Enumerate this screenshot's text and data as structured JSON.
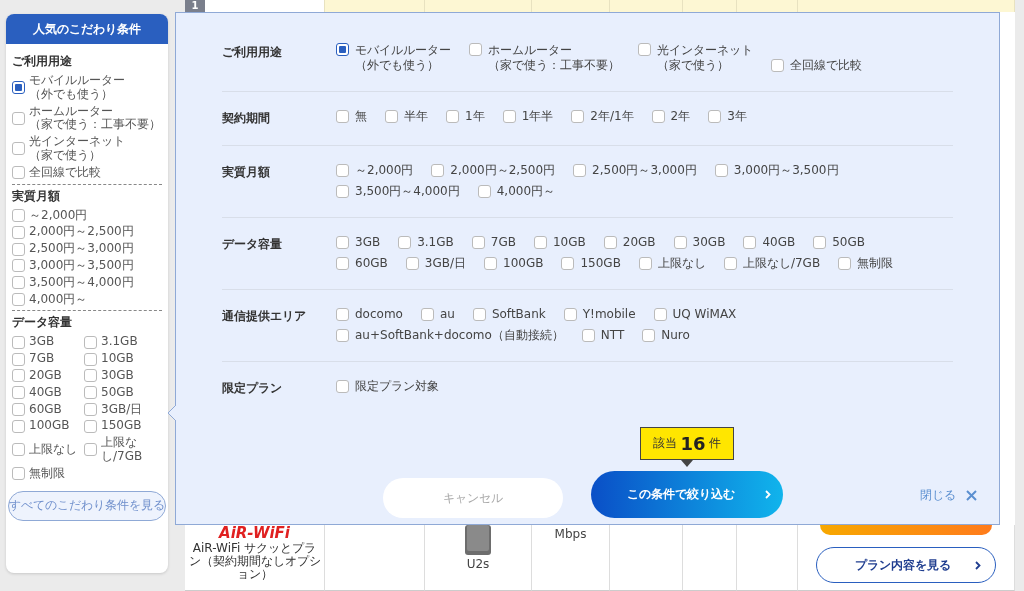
{
  "sidebar": {
    "title": "人気のこだわり条件",
    "sections": [
      {
        "heading": "ご利用用途",
        "kind": "list",
        "options": [
          {
            "label": "モバイルルーター",
            "note": "（外でも使う）",
            "checked": true
          },
          {
            "label": "ホームルーター",
            "note": "（家で使う：工事不要）",
            "checked": false
          },
          {
            "label": "光インターネット",
            "note": "（家で使う）",
            "checked": false
          },
          {
            "label": "全回線で比較",
            "checked": false
          }
        ]
      },
      {
        "heading": "実質月額",
        "kind": "list",
        "options": [
          {
            "label": "～2,000円",
            "checked": false
          },
          {
            "label": "2,000円～2,500円",
            "checked": false
          },
          {
            "label": "2,500円～3,000円",
            "checked": false
          },
          {
            "label": "3,000円～3,500円",
            "checked": false
          },
          {
            "label": "3,500円～4,000円",
            "checked": false
          },
          {
            "label": "4,000円～",
            "checked": false
          }
        ]
      },
      {
        "heading": "データ容量",
        "kind": "grid",
        "options": [
          {
            "label": "3GB",
            "checked": false
          },
          {
            "label": "3.1GB",
            "checked": false
          },
          {
            "label": "7GB",
            "checked": false
          },
          {
            "label": "10GB",
            "checked": false
          },
          {
            "label": "20GB",
            "checked": false
          },
          {
            "label": "30GB",
            "checked": false
          },
          {
            "label": "40GB",
            "checked": false
          },
          {
            "label": "50GB",
            "checked": false
          },
          {
            "label": "60GB",
            "checked": false
          },
          {
            "label": "3GB/日",
            "checked": false
          },
          {
            "label": "100GB",
            "checked": false
          },
          {
            "label": "150GB",
            "checked": false
          },
          {
            "label": "上限なし",
            "checked": false
          },
          {
            "label": "上限なし/7GB",
            "checked": false
          },
          {
            "label": "無制限",
            "checked": false
          }
        ]
      }
    ],
    "button": "すべてのこだわり条件を見る"
  },
  "table": {
    "rank": "1",
    "logo": "AiR-WiFi",
    "plan_caption": "AiR-WiFi サクッとプラン（契約期間なしオプション）",
    "device": "U2s",
    "speed_unit": "Mbps",
    "plan_button": "プラン内容を見る"
  },
  "panel": {
    "rows": [
      {
        "label": "ご利用用途",
        "lines": [
          [
            {
              "label": "モバイルルーター",
              "note": "（外でも使う）",
              "checked": true
            },
            {
              "label": "ホームルーター",
              "note": "（家で使う：工事不要）",
              "checked": false
            },
            {
              "label": "光インターネット",
              "note": "（家で使う）",
              "checked": false
            },
            {
              "label": "全回線で比較",
              "checked": false
            }
          ]
        ]
      },
      {
        "label": "契約期間",
        "lines": [
          [
            {
              "label": "無",
              "checked": false
            },
            {
              "label": "半年",
              "checked": false
            },
            {
              "label": "1年",
              "checked": false
            },
            {
              "label": "1年半",
              "checked": false
            },
            {
              "label": "2年/1年",
              "checked": false
            },
            {
              "label": "2年",
              "checked": false
            },
            {
              "label": "3年",
              "checked": false
            }
          ]
        ]
      },
      {
        "label": "実質月額",
        "lines": [
          [
            {
              "label": "～2,000円",
              "checked": false
            },
            {
              "label": "2,000円～2,500円",
              "checked": false
            },
            {
              "label": "2,500円～3,000円",
              "checked": false
            },
            {
              "label": "3,000円～3,500円",
              "checked": false
            }
          ],
          [
            {
              "label": "3,500円～4,000円",
              "checked": false
            },
            {
              "label": "4,000円～",
              "checked": false
            }
          ]
        ]
      },
      {
        "label": "データ容量",
        "lines": [
          [
            {
              "label": "3GB",
              "checked": false
            },
            {
              "label": "3.1GB",
              "checked": false
            },
            {
              "label": "7GB",
              "checked": false
            },
            {
              "label": "10GB",
              "checked": false
            },
            {
              "label": "20GB",
              "checked": false
            },
            {
              "label": "30GB",
              "checked": false
            },
            {
              "label": "40GB",
              "checked": false
            },
            {
              "label": "50GB",
              "checked": false
            }
          ],
          [
            {
              "label": "60GB",
              "checked": false
            },
            {
              "label": "3GB/日",
              "checked": false
            },
            {
              "label": "100GB",
              "checked": false
            },
            {
              "label": "150GB",
              "checked": false
            },
            {
              "label": "上限なし",
              "checked": false
            },
            {
              "label": "上限なし/7GB",
              "checked": false
            },
            {
              "label": "無制限",
              "checked": false
            }
          ]
        ]
      },
      {
        "label": "通信提供エリア",
        "lines": [
          [
            {
              "label": "docomo",
              "checked": false
            },
            {
              "label": "au",
              "checked": false
            },
            {
              "label": "SoftBank",
              "checked": false
            },
            {
              "label": "Y!mobile",
              "checked": false
            },
            {
              "label": "UQ WiMAX",
              "checked": false
            }
          ],
          [
            {
              "label": "au+SoftBank+docomo（自動接続）",
              "checked": false
            },
            {
              "label": "NTT",
              "checked": false
            },
            {
              "label": "Nuro",
              "checked": false
            }
          ]
        ]
      },
      {
        "label": "限定プラン",
        "lines": [
          [
            {
              "label": "限定プラン対象",
              "checked": false
            }
          ]
        ]
      }
    ],
    "count_badge": {
      "prefix": "該当",
      "count": "16",
      "suffix": "件"
    },
    "cancel": "キャンセル",
    "apply": "この条件で絞り込む",
    "close": "閉じる"
  }
}
